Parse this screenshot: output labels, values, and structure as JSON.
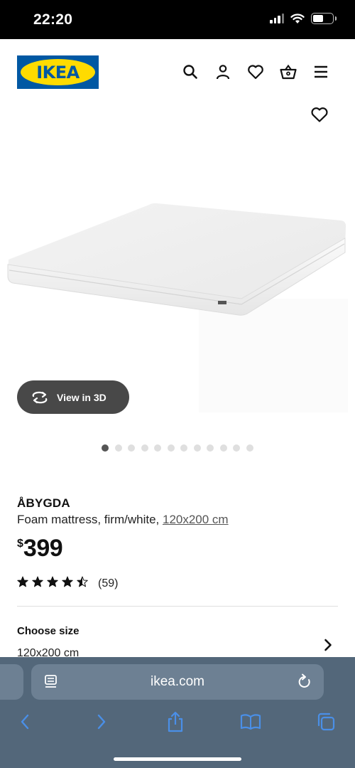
{
  "status_bar": {
    "time": "22:20"
  },
  "header": {
    "logo_text": "IKEA"
  },
  "gallery": {
    "view3d_label": "View in 3D",
    "dot_count": 12,
    "active_dot": 0
  },
  "product": {
    "name": "ÅBYGDA",
    "description": "Foam mattress, firm/white, ",
    "size_link": "120x200 cm",
    "currency": "$",
    "price": "399",
    "rating_stars": 4.5,
    "review_count": "(59)"
  },
  "size_selector": {
    "label": "Choose size",
    "value": "120x200 cm"
  },
  "browser": {
    "address": "ikea.com"
  },
  "colors": {
    "ikea_blue": "#0058A3",
    "ikea_yellow": "#FFDB00",
    "browser_bar": "#53677a",
    "browser_accent": "#4a8fe7"
  }
}
